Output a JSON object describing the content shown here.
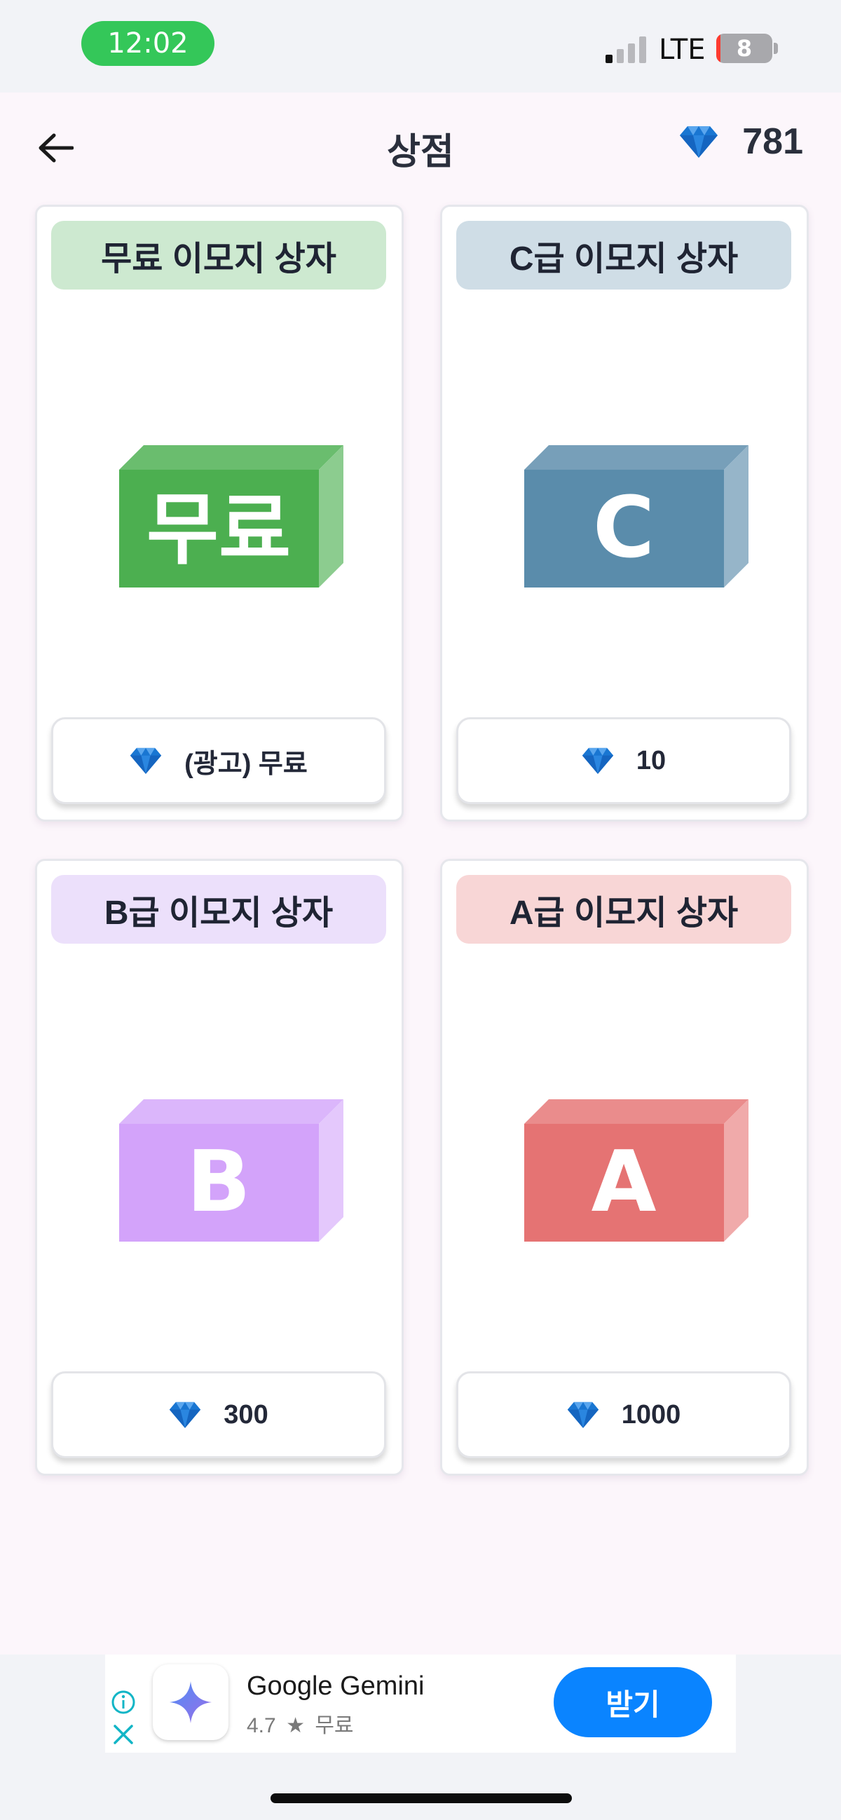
{
  "status_bar": {
    "time": "12:02",
    "network": "LTE",
    "battery": "8",
    "battery_level": 0.08,
    "signal_bars_active": 1,
    "signal_bars_total": 4
  },
  "header": {
    "title": "상점",
    "back_icon": "arrow-left-icon",
    "currency_icon": "diamond-icon",
    "balance": "781"
  },
  "boxes": [
    {
      "title": "무료 이모지 상자",
      "box_label": "무료",
      "price": "(광고) 무료",
      "title_bg": "#cde9d0",
      "box_colors": {
        "front": "#4caf50",
        "top": "#6abd6e",
        "side": "#8ccc8f"
      }
    },
    {
      "title": "C급 이모지 상자",
      "box_label": "C",
      "price": "10",
      "title_bg": "#cfdde6",
      "box_colors": {
        "front": "#5a8cab",
        "top": "#779fb9",
        "side": "#96b5c9"
      }
    },
    {
      "title": "B급 이모지 상자",
      "box_label": "B",
      "price": "300",
      "title_bg": "#ece0fb",
      "box_colors": {
        "front": "#d3a3fa",
        "top": "#dbb6fb",
        "side": "#e4c8fc"
      }
    },
    {
      "title": "A급 이모지 상자",
      "box_label": "A",
      "price": "1000",
      "title_bg": "#f8d6d6",
      "box_colors": {
        "front": "#e57373",
        "top": "#ea8c8c",
        "side": "#f0aaaa"
      }
    }
  ],
  "ad": {
    "app_name": "Google Gemini",
    "rating": "4.7",
    "rating_icon": "star-icon",
    "price_label": "무료",
    "cta": "받기"
  },
  "colors": {
    "accent_blue": "#1976d2",
    "ad_button": "#0a84ff",
    "time_pill": "#34c759"
  }
}
